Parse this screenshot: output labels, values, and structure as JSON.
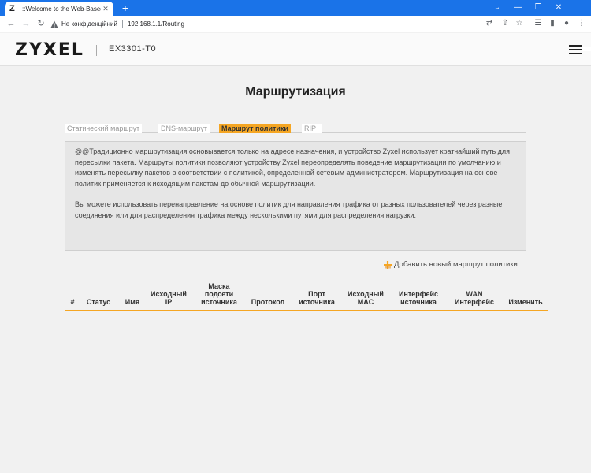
{
  "browser": {
    "tab_title": "::Welcome to the Web-Based Configurator::",
    "tab_favicon": "Z",
    "tab_close": "✕",
    "new_tab": "+",
    "security_label": "Не конфіденційний",
    "url": "192.168.1.1/Routing"
  },
  "header": {
    "logo": "ZYXEL",
    "model": "EX3301-T0"
  },
  "page": {
    "title": "Маршрутизация"
  },
  "tabs": [
    {
      "label": "Статический маршрут",
      "active": false
    },
    {
      "label": "DNS-маршрут",
      "active": false
    },
    {
      "label": "Маршрут политики",
      "active": true
    },
    {
      "label": "RIP",
      "active": false
    }
  ],
  "info": {
    "paragraph1": "@@Традиционно маршрутизация основывается только на адресе назначения, и устройство Zyxel использует кратчайший путь для пересылки пакета. Маршруты политики позволяют устройству Zyxel переопределять поведение маршрутизации по умолчанию и изменять пересылку пакетов в соответствии с политикой, определенной сетевым администратором. Маршрутизация на основе политик применяется к исходящим пакетам до обычной маршрутизации.",
    "paragraph2": "Вы можете использовать перенаправление на основе политик для направления трафика от разных пользователей через разные соединения или для распределения трафика между несколькими путями для распределения нагрузки."
  },
  "add_link": {
    "label": "Добавить новый маршрут политики"
  },
  "table": {
    "columns": [
      {
        "key": "index",
        "label": "#"
      },
      {
        "key": "status",
        "label": "Статус"
      },
      {
        "key": "name",
        "label": "Имя"
      },
      {
        "key": "src_ip",
        "label": "Исходный IP"
      },
      {
        "key": "src_mask",
        "label": "Маска подсети источника"
      },
      {
        "key": "protocol",
        "label": "Протокол"
      },
      {
        "key": "src_port",
        "label": "Порт источника"
      },
      {
        "key": "src_mac",
        "label": "Исходный MAC"
      },
      {
        "key": "src_iface",
        "label": "Интерфейс источника"
      },
      {
        "key": "wan_iface",
        "label": "WAN Интерфейс"
      },
      {
        "key": "edit",
        "label": "Изменить"
      }
    ],
    "rows": []
  },
  "colors": {
    "accent": "#f5a623",
    "chrome_blue": "#1a73e8"
  }
}
